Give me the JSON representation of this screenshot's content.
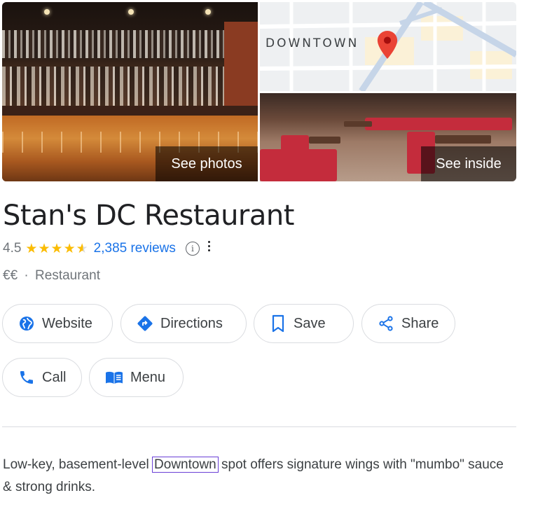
{
  "photos": {
    "main_label": "See photos",
    "inside_label": "See inside",
    "map_label": "DOWNTOWN"
  },
  "place": {
    "name": "Stan's DC Restaurant",
    "rating": "4.5",
    "rating_value": 4.5,
    "reviews": "2,385 reviews",
    "price": "€€",
    "separator": "·",
    "category": "Restaurant"
  },
  "actions": {
    "website": "Website",
    "directions": "Directions",
    "save": "Save",
    "share": "Share",
    "call": "Call",
    "menu": "Menu"
  },
  "description": {
    "before": "Low-key, basement-level ",
    "highlight": "Downtown",
    "after": " spot offers signature wings with \"mumbo\" sauce & strong drinks."
  },
  "colors": {
    "accent_blue": "#1a73e8",
    "star_yellow": "#fbbc04",
    "map_pin_red": "#ea4335",
    "highlight_outline": "#6a3fd6"
  },
  "icons": [
    "globe-icon",
    "directions-icon",
    "bookmark-icon",
    "share-icon",
    "phone-icon",
    "menu-book-icon",
    "info-icon",
    "more-vert-icon",
    "map-pin-icon",
    "star-icon"
  ]
}
